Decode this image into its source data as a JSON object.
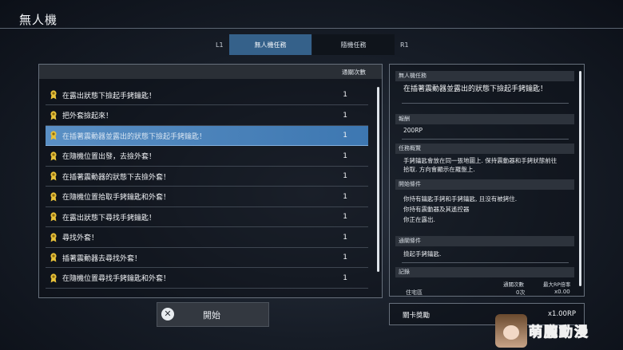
{
  "header": {
    "title": "無人機"
  },
  "tabs": {
    "left_key": "L1",
    "right_key": "R1",
    "items": [
      {
        "label": "無人機任務",
        "active": true
      },
      {
        "label": "隨機任務",
        "active": false
      }
    ]
  },
  "mission_list": {
    "column_header": "通關次數",
    "rows": [
      {
        "name": "在露出狀態下撿起手銬鑰匙！",
        "count": "1",
        "selected": false
      },
      {
        "name": "把外套撿起來！",
        "count": "1",
        "selected": false
      },
      {
        "name": "在插著震動器並露出的狀態下撿起手銬鑰匙！",
        "count": "1",
        "selected": true
      },
      {
        "name": "在隨機位置出發，去撿外套！",
        "count": "1",
        "selected": false
      },
      {
        "name": "在插著震動器的狀態下去撿外套！",
        "count": "1",
        "selected": false
      },
      {
        "name": "在隨機位置拾取手銬鑰匙和外套！",
        "count": "1",
        "selected": false
      },
      {
        "name": "在露出狀態下尋找手銬鑰匙！",
        "count": "1",
        "selected": false
      },
      {
        "name": "尋找外套！",
        "count": "1",
        "selected": false
      },
      {
        "name": "插著震動器去尋找外套！",
        "count": "1",
        "selected": false
      },
      {
        "name": "在隨機位置尋找手銬鑰匙和外套！",
        "count": "1",
        "selected": false
      }
    ]
  },
  "start_button": {
    "key": "✕",
    "label": "開始"
  },
  "details": {
    "mission_header": "無人機任務",
    "mission_name": "在插著震動器並露出的狀態下撿起手銬鑰匙！",
    "reward_header": "報酬",
    "reward_value": "200RP",
    "overview_header": "任務概覽",
    "overview_lines": [
      "手銬鑰匙會放在同一張地圖上. 保持震動器和手銬狀態前往",
      "拾取. 方向會顯示在羅盤上."
    ],
    "start_cond_header": "開始條件",
    "start_cond_lines": [
      "你持有鑰匙手銬和手銬鑰匙, 且沒有被銬住.",
      "你持有震動器及其遙控器",
      "你正在露出."
    ],
    "clear_cond_header": "通關條件",
    "clear_cond_value": "撿起手銬鑰匙.",
    "record_header": "記錄",
    "record_col1": "通關次數",
    "record_col2": "最大RP倍率",
    "record_row_label": "住宅區",
    "record_row_count": "0次",
    "record_row_rate": "x0.00"
  },
  "stage_reward": {
    "label": "關卡獎勵",
    "value": "x1.00RP"
  },
  "watermark": {
    "text": "萌朧動漫"
  },
  "colors": {
    "accent": "#35618a",
    "selected_row": "#4a86c0",
    "badge": "#e8c23a"
  }
}
